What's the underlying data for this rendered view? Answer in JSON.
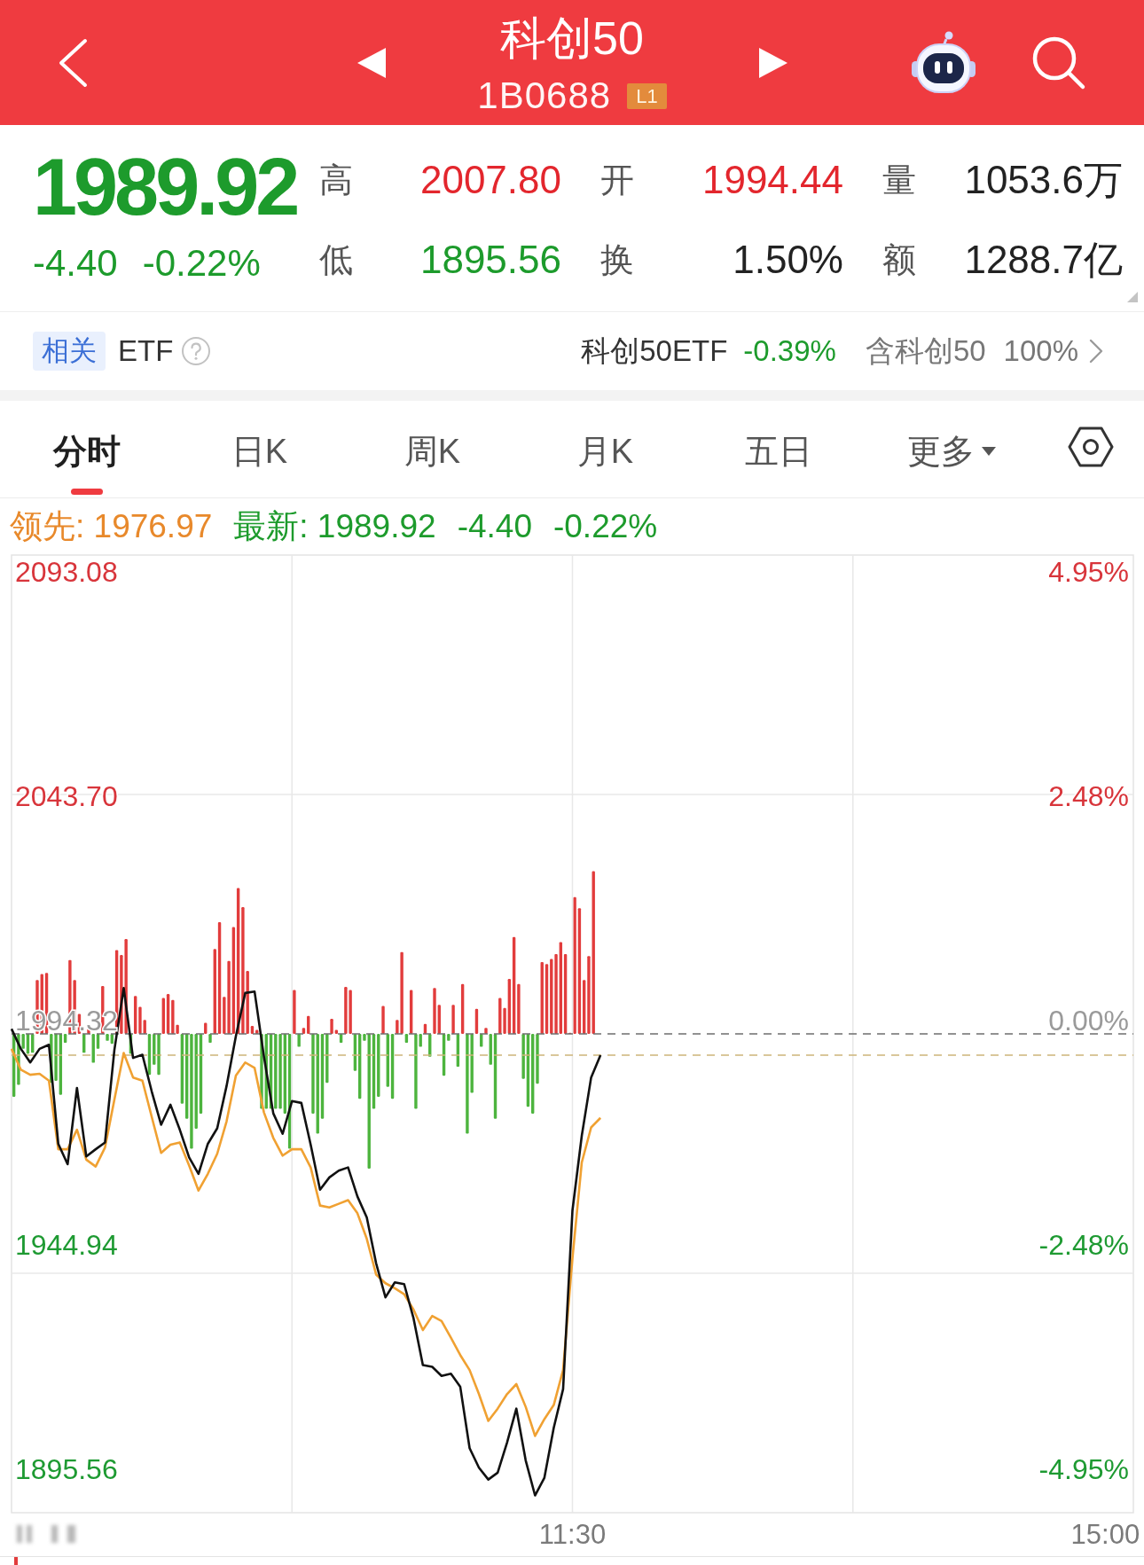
{
  "header": {
    "title": "科创50",
    "code": "1B0688",
    "badge": "L1"
  },
  "quote": {
    "price": "1989.92",
    "change": "-4.40",
    "change_percent": "-0.22%",
    "color": "#1d9b2c",
    "stats": [
      [
        {
          "label": "高",
          "value": "2007.80",
          "color": "#e3262d"
        },
        {
          "label": "开",
          "value": "1994.44",
          "color": "#e3262d"
        },
        {
          "label": "量",
          "value": "1053.6万",
          "color": "#222222"
        }
      ],
      [
        {
          "label": "低",
          "value": "1895.56",
          "color": "#1d9b2c"
        },
        {
          "label": "换",
          "value": "1.50%",
          "color": "#222222"
        },
        {
          "label": "额",
          "value": "1288.7亿",
          "color": "#222222"
        }
      ]
    ]
  },
  "related": {
    "tag": "相关",
    "label": "ETF",
    "links": [
      {
        "text": "科创50ETF",
        "color": "#333333"
      },
      {
        "text": "-0.39%",
        "color": "#1d9b2c"
      },
      {
        "text": "含科创50",
        "color": "#777777"
      },
      {
        "text": "100%",
        "color": "#777777"
      }
    ]
  },
  "tabs": [
    {
      "label": "分时",
      "selected": true,
      "kind": "tab"
    },
    {
      "label": "日K",
      "selected": false,
      "kind": "tab"
    },
    {
      "label": "周K",
      "selected": false,
      "kind": "tab"
    },
    {
      "label": "月K",
      "selected": false,
      "kind": "tab"
    },
    {
      "label": "五日",
      "selected": false,
      "kind": "tab"
    },
    {
      "label": "更多",
      "selected": false,
      "kind": "menu"
    }
  ],
  "legend": [
    {
      "text": "领先: 1976.97",
      "color": "#e8892b"
    },
    {
      "text": "最新: 1989.92",
      "color": "#1d9b2c"
    },
    {
      "text": "-4.40",
      "color": "#1d9b2c"
    },
    {
      "text": "-0.22%",
      "color": "#1d9b2c"
    }
  ],
  "chart": {
    "right_labels": [
      "4.95%",
      "2.48%",
      "0.00%",
      "-2.48%",
      "-4.95%"
    ],
    "chart_data": {
      "type": "line",
      "categories": [
        null,
        null,
        null,
        null,
        null,
        null,
        null,
        null,
        null,
        null,
        null,
        null,
        null,
        null,
        null,
        null,
        null,
        null,
        null,
        null,
        null,
        null,
        null,
        null,
        null,
        null,
        null,
        null,
        null,
        null,
        null,
        null,
        null,
        null,
        null,
        null,
        null,
        null,
        null,
        null,
        null,
        null,
        null,
        null,
        null,
        null,
        null,
        null,
        null,
        null,
        null,
        null,
        null,
        null,
        null,
        null,
        null,
        null,
        null,
        null,
        "11:30",
        null,
        null,
        null,
        null,
        null,
        null,
        null,
        null,
        null,
        null,
        null,
        null,
        null,
        null,
        null,
        null,
        null,
        null,
        null,
        null,
        null,
        null,
        null,
        null,
        null,
        null,
        null,
        null,
        null,
        null,
        null,
        null,
        null,
        null,
        null,
        null,
        null,
        null,
        null,
        null,
        null,
        null,
        null,
        null,
        null,
        null,
        null,
        null,
        null,
        null,
        null,
        null,
        null,
        null,
        null,
        null,
        "15:00",
        null,
        null,
        null
      ],
      "ylim": [
        1886.0,
        2096.79
      ],
      "yticks": [
        {
          "value": 2093.08,
          "label": "2093.08"
        },
        {
          "value": 2043.7,
          "label": "2043.70"
        },
        {
          "value": 1994.32,
          "label": "1994.32"
        },
        {
          "value": 1944.94,
          "label": "1944.94"
        },
        {
          "value": 1895.56,
          "label": "1895.56"
        }
      ],
      "series": [
        {
          "color": "#f0a132",
          "values": [
            1988.1,
            1983.5,
            1982.4,
            1982.6,
            1981.1,
            1966.0,
            1966.0,
            1970.3,
            1963.7,
            1962.2,
            1966.4,
            1976.9,
            1987.2,
            1981.8,
            1981.1,
            1973.1,
            1965.2,
            1967.0,
            1967.5,
            1962.4,
            1956.9,
            1960.6,
            1965.0,
            1972.1,
            1982.2,
            1985.1,
            1983.9,
            1974.1,
            1968.5,
            1964.6,
            1966.0,
            1966.0,
            1962.0,
            1953.6,
            1953.2,
            1954.0,
            1954.8,
            1951.9,
            1946.3,
            1938.4,
            1936.5,
            1935.4,
            1934.1,
            1930.7,
            1926.2,
            1929.3,
            1928.2,
            1924.5,
            1920.7,
            1917.4,
            1912.1,
            1906.2,
            1908.9,
            1912.1,
            1914.3,
            1909.3,
            1902.9,
            1906.6,
            1909.7,
            1917.4,
            1942.0,
            1963.1,
            1970.8,
            1972.9,
            null,
            null,
            null,
            null,
            null,
            null,
            null,
            null,
            null,
            null,
            null,
            null,
            null,
            null,
            null,
            null,
            null,
            null,
            null,
            null,
            null,
            null,
            null,
            null,
            null,
            null,
            null,
            null,
            null,
            null,
            null,
            null,
            null,
            null,
            null,
            null,
            null,
            null,
            null,
            null,
            null,
            null,
            null,
            null,
            null,
            null,
            null,
            null,
            null,
            null,
            null,
            null,
            null,
            null,
            null,
            null,
            null
          ]
        },
        {
          "color": "#111111",
          "values": [
            1992.5,
            1988.1,
            1985.1,
            1988.1,
            1989.0,
            1967.2,
            1962.7,
            1979.5,
            1964.4,
            1966.0,
            1967.5,
            1987.8,
            2001.5,
            1986.1,
            1986.8,
            1978.7,
            1971.4,
            1975.8,
            1970.3,
            1964.2,
            1960.6,
            1967.2,
            1970.6,
            1979.9,
            1990.9,
            2000.4,
            2000.7,
            1986.4,
            1973.9,
            1969.4,
            1976.6,
            1976.2,
            1967.0,
            1957.1,
            1959.8,
            1961.3,
            1962.0,
            1955.6,
            1951.0,
            1940.9,
            1933.4,
            1936.7,
            1936.3,
            1928.8,
            1918.5,
            1918.1,
            1916.1,
            1916.6,
            1913.7,
            1900.2,
            1895.9,
            1893.3,
            1894.8,
            1901.4,
            1908.9,
            1897.5,
            1889.8,
            1893.7,
            1904.7,
            1913.2,
            1952.5,
            1969.0,
            1981.8,
            1986.7,
            null,
            null,
            null,
            null,
            null,
            null,
            null,
            null,
            null,
            null,
            null,
            null,
            null,
            null,
            null,
            null,
            null,
            null,
            null,
            null,
            null,
            null,
            null,
            null,
            null,
            null,
            null,
            null,
            null,
            null,
            null,
            null,
            null,
            null,
            null,
            null,
            null,
            null,
            null,
            null,
            null,
            null,
            null,
            null,
            null,
            null,
            null,
            null,
            null,
            null,
            null,
            null,
            null,
            null,
            null,
            null,
            null
          ]
        }
      ],
      "ref_lines": [
        {
          "axis": "y",
          "value": 1991.4,
          "color": "#6e6e6e"
        },
        {
          "axis": "y",
          "value": 1986.7,
          "color": "#cdb57a"
        }
      ]
    }
  }
}
